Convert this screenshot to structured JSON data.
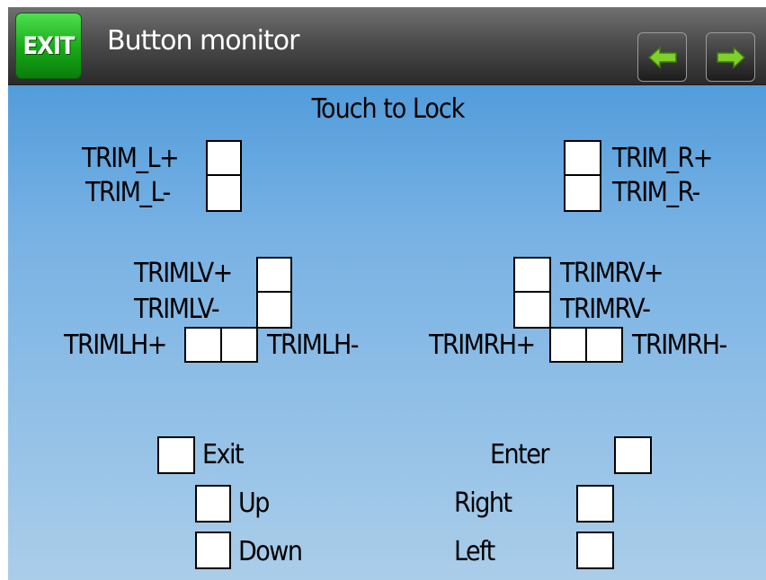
{
  "header": {
    "exit_label": "EXIT",
    "title": "Button monitor",
    "nav_prev_icon": "arrow-left-icon",
    "nav_next_icon": "arrow-right-icon",
    "arrow_color": "#7fd12a"
  },
  "hint": "Touch to Lock",
  "trims": {
    "trim_l_plus": "TRIM_L+",
    "trim_l_minus": "TRIM_L-",
    "trim_r_plus": "TRIM_R+",
    "trim_r_minus": "TRIM_R-",
    "trimlv_plus": "TRIMLV+",
    "trimlv_minus": "TRIMLV-",
    "trimlh_plus": "TRIMLH+",
    "trimlh_minus": "TRIMLH-",
    "trimrv_plus": "TRIMRV+",
    "trimrv_minus": "TRIMRV-",
    "trimrh_plus": "TRIMRH+",
    "trimrh_minus": "TRIMRH-"
  },
  "keys": {
    "exit": "Exit",
    "up": "Up",
    "down": "Down",
    "enter": "Enter",
    "right": "Right",
    "left": "Left"
  }
}
